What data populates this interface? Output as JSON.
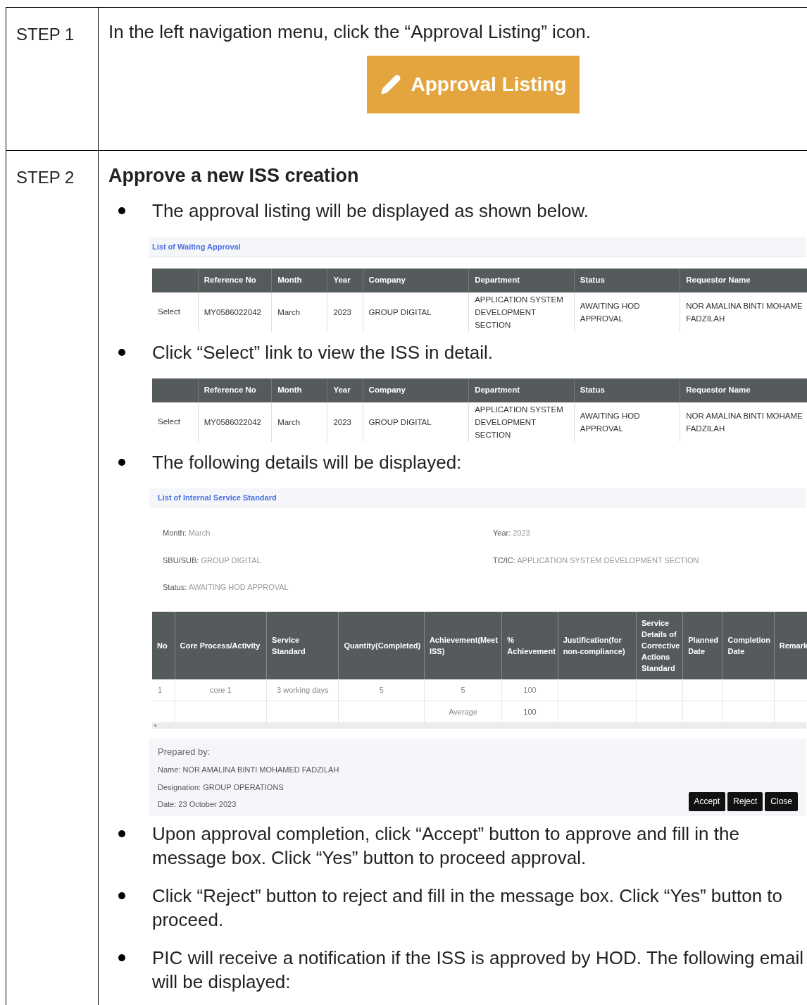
{
  "steps": [
    {
      "label": "STEP 1",
      "blocks": [
        {
          "kind": "text",
          "text": "In the left navigation menu, click the “Approval Listing” icon."
        },
        {
          "kind": "button",
          "label": "Approval Listing"
        }
      ]
    },
    {
      "label": "STEP 2",
      "blocks": [
        {
          "kind": "heading",
          "text": "Approve a new ISS creation"
        },
        {
          "kind": "bullet",
          "text": "The approval listing will be displayed as shown below."
        },
        {
          "kind": "listing",
          "title": "List of Waiting Approval",
          "columns": [
            "Reference No",
            "Month",
            "Year",
            "Company",
            "Department",
            "Status",
            "Requestor Name"
          ],
          "rows": [
            {
              "link": "Select",
              "cells": [
                "MY0586022042",
                "March",
                "2023",
                "GROUP DIGITAL",
                "APPLICATION SYSTEM DEVELOPMENT SECTION",
                "AWAITING HOD APPROVAL",
                "NOR AMALINA BINTI MOHAME FADZILAH"
              ]
            }
          ]
        },
        {
          "kind": "bullet",
          "text": "Click “Select” link to view the ISS in detail."
        },
        {
          "kind": "listing",
          "columns": [
            "Reference No",
            "Month",
            "Year",
            "Company",
            "Department",
            "Status",
            "Requestor Name"
          ],
          "rows": [
            {
              "link": "Select",
              "cells": [
                "MY0586022042",
                "March",
                "2023",
                "GROUP DIGITAL",
                "APPLICATION SYSTEM DEVELOPMENT SECTION",
                "AWAITING HOD APPROVAL",
                "NOR AMALINA BINTI MOHAME FADZILAH"
              ]
            }
          ]
        },
        {
          "kind": "bullet",
          "text": "The following details will be displayed:"
        },
        {
          "kind": "details",
          "title": "List of Internal Service Standard",
          "fields": [
            {
              "label": "Month:",
              "value": "March"
            },
            {
              "label": "Year:",
              "value": "2023"
            },
            {
              "label": "SBU/SUB:",
              "value": "GROUP DIGITAL"
            },
            {
              "label": "TC/IC:",
              "value": "APPLICATION SYSTEM DEVELOPMENT SECTION"
            },
            {
              "label": "Status:",
              "value": "AWAITING HOD APPROVAL"
            }
          ],
          "columns": [
            "No",
            "Core Process/Activity",
            "Service Standard",
            "Quantity(Completed)",
            "Achievement(Meet ISS)",
            "% Achievement",
            "Justification(for non-compliance)",
            "Service Details of Corrective Actions Standard",
            "Planned Date",
            "Completion Date",
            "Remark"
          ],
          "rows": [
            [
              "1",
              "core 1",
              "3 working days",
              "5",
              "5",
              "100"
            ]
          ],
          "average": {
            "label": "Average",
            "value": "100"
          },
          "prepared": {
            "heading": "Prepared by:",
            "lines": [
              "Name: NOR AMALINA BINTI MOHAMED FADZILAH",
              "Designation: GROUP OPERATIONS",
              "Date: 23 October 2023"
            ]
          },
          "buttons": [
            "Accept",
            "Reject",
            "Close"
          ]
        },
        {
          "kind": "bullet",
          "text": "Upon approval completion, click “Accept” button to approve and fill in the message box. Click “Yes” button to proceed approval."
        },
        {
          "kind": "bullet",
          "text": "Click “Reject” button to reject and fill in the message box. Click “Yes” button to proceed."
        },
        {
          "kind": "bullet",
          "justify": true,
          "text": "PIC will receive a notification if the ISS is approved by HOD. The following email will be displayed:"
        }
      ]
    }
  ]
}
